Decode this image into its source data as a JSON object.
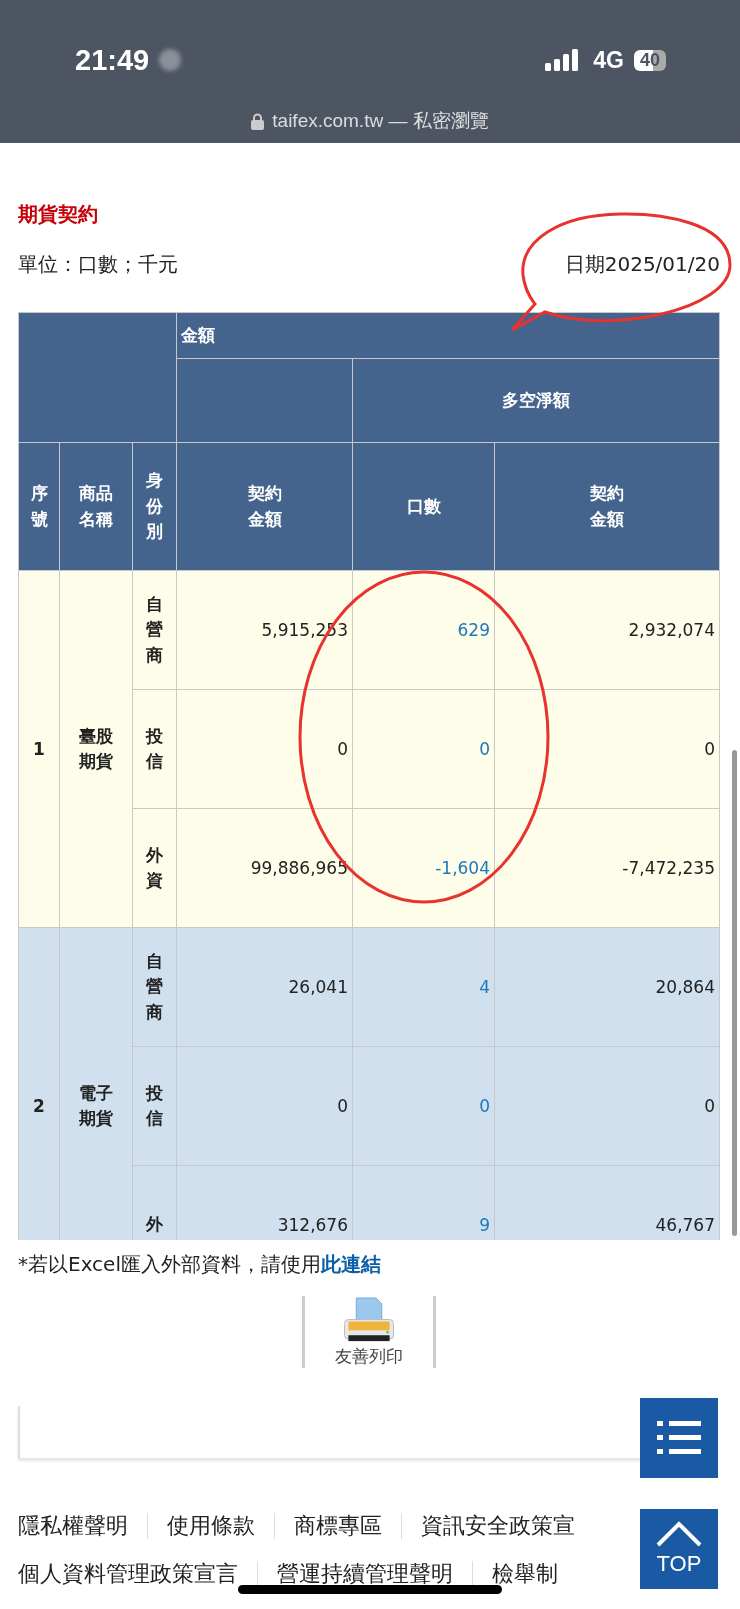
{
  "status_bar": {
    "time": "21:49",
    "network": "4G",
    "battery": "40"
  },
  "address_bar": {
    "url": "taifex.com.tw — 私密瀏覽"
  },
  "title": "期貨契約",
  "units": "單位：口數；千元",
  "date": "日期2025/01/20",
  "table": {
    "group_header": "金額",
    "sub_header": "多空淨額",
    "columns": [
      "序號",
      "商品名稱",
      "身份別",
      "契約金額",
      "口數",
      "契約金額"
    ],
    "groups": [
      {
        "index": "1",
        "name": "臺股期貨",
        "rows": [
          {
            "identity": "自營商",
            "amount": "5,915,253",
            "lots": "629",
            "net": "2,932,074"
          },
          {
            "identity": "投信",
            "amount": "0",
            "lots": "0",
            "net": "0"
          },
          {
            "identity": "外資",
            "amount": "99,886,965",
            "lots": "-1,604",
            "net": "-7,472,235"
          }
        ]
      },
      {
        "index": "2",
        "name": "電子期貨",
        "rows": [
          {
            "identity": "自營商",
            "amount": "26,041",
            "lots": "4",
            "net": "20,864"
          },
          {
            "identity": "投信",
            "amount": "0",
            "lots": "0",
            "net": "0"
          },
          {
            "identity": "外",
            "amount": "312,676",
            "lots": "9",
            "net": "46,767"
          }
        ]
      }
    ]
  },
  "note": {
    "text": "*若以Excel匯入外部資料，請使用",
    "link": "此連結"
  },
  "print_button": "友善列印",
  "footer_links": [
    [
      "隱私權聲明",
      "使用條款",
      "商標專區",
      "資訊安全政策宣"
    ],
    [
      "個人資料管理政策宣言",
      "營運持續管理聲明",
      "檢舉制"
    ]
  ],
  "top_button": "TOP"
}
